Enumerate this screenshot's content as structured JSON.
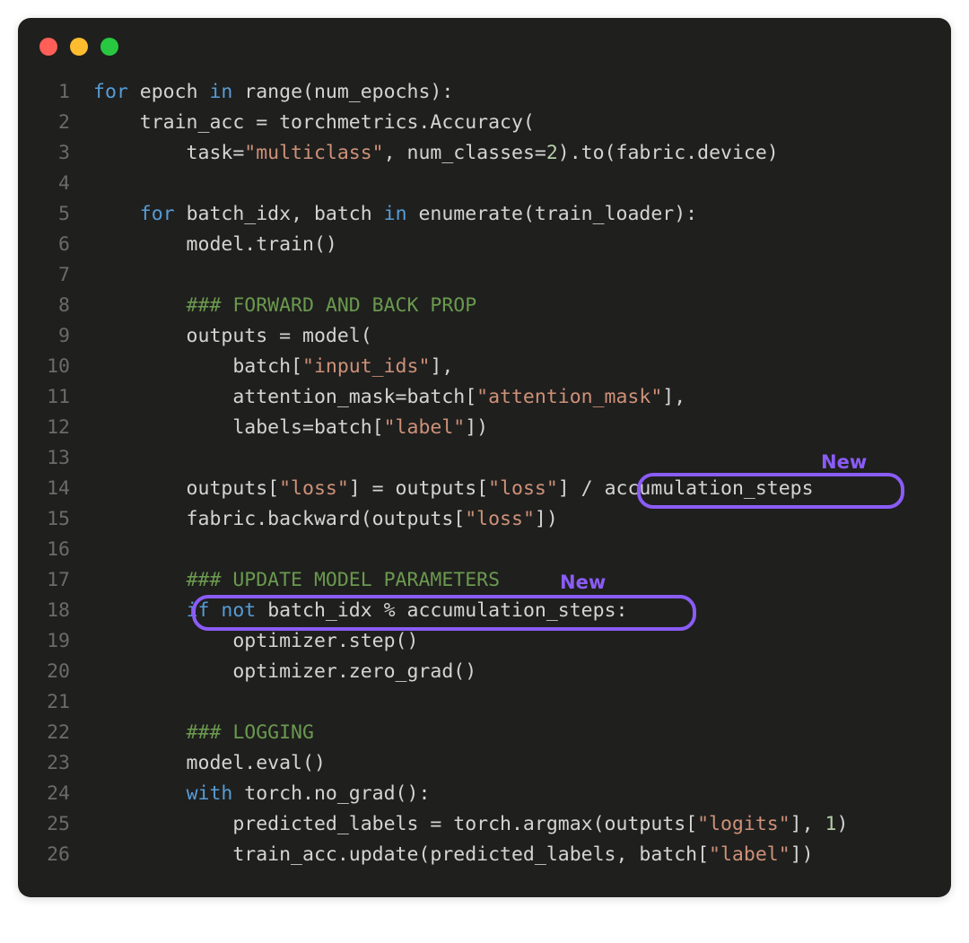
{
  "window": {
    "traffic_lights": [
      "close",
      "minimize",
      "zoom"
    ]
  },
  "annotations": {
    "new_label_1": "New",
    "new_label_2": "New"
  },
  "code": {
    "lines": [
      {
        "n": 1,
        "tokens": [
          [
            "kw",
            "for"
          ],
          [
            "id",
            " epoch "
          ],
          [
            "kw",
            "in"
          ],
          [
            "id",
            " range(num_epochs):"
          ]
        ]
      },
      {
        "n": 2,
        "tokens": [
          [
            "id",
            "    train_acc = torchmetrics.Accuracy("
          ]
        ]
      },
      {
        "n": 3,
        "tokens": [
          [
            "id",
            "        task="
          ],
          [
            "str",
            "\"multiclass\""
          ],
          [
            "id",
            ", num_classes="
          ],
          [
            "num",
            "2"
          ],
          [
            "id",
            ").to(fabric.device)"
          ]
        ]
      },
      {
        "n": 4,
        "tokens": [
          [
            "id",
            ""
          ]
        ]
      },
      {
        "n": 5,
        "tokens": [
          [
            "id",
            "    "
          ],
          [
            "kw",
            "for"
          ],
          [
            "id",
            " batch_idx, batch "
          ],
          [
            "kw",
            "in"
          ],
          [
            "id",
            " enumerate(train_loader):"
          ]
        ]
      },
      {
        "n": 6,
        "tokens": [
          [
            "id",
            "        model.train()"
          ]
        ]
      },
      {
        "n": 7,
        "tokens": [
          [
            "id",
            ""
          ]
        ]
      },
      {
        "n": 8,
        "tokens": [
          [
            "id",
            "        "
          ],
          [
            "cmt",
            "### FORWARD AND BACK PROP"
          ]
        ]
      },
      {
        "n": 9,
        "tokens": [
          [
            "id",
            "        outputs = model("
          ]
        ]
      },
      {
        "n": 10,
        "tokens": [
          [
            "id",
            "            batch["
          ],
          [
            "str",
            "\"input_ids\""
          ],
          [
            "id",
            "],"
          ]
        ]
      },
      {
        "n": 11,
        "tokens": [
          [
            "id",
            "            attention_mask=batch["
          ],
          [
            "str",
            "\"attention_mask\""
          ],
          [
            "id",
            "],"
          ]
        ]
      },
      {
        "n": 12,
        "tokens": [
          [
            "id",
            "            labels=batch["
          ],
          [
            "str",
            "\"label\""
          ],
          [
            "id",
            "])"
          ]
        ]
      },
      {
        "n": 13,
        "tokens": [
          [
            "id",
            ""
          ]
        ]
      },
      {
        "n": 14,
        "tokens": [
          [
            "id",
            "        outputs["
          ],
          [
            "str",
            "\"loss\""
          ],
          [
            "id",
            "] = outputs["
          ],
          [
            "str",
            "\"loss\""
          ],
          [
            "id",
            "] / accumulation_steps"
          ]
        ]
      },
      {
        "n": 15,
        "tokens": [
          [
            "id",
            "        fabric.backward(outputs["
          ],
          [
            "str",
            "\"loss\""
          ],
          [
            "id",
            "])"
          ]
        ]
      },
      {
        "n": 16,
        "tokens": [
          [
            "id",
            ""
          ]
        ]
      },
      {
        "n": 17,
        "tokens": [
          [
            "id",
            "        "
          ],
          [
            "cmt",
            "### UPDATE MODEL PARAMETERS"
          ]
        ]
      },
      {
        "n": 18,
        "tokens": [
          [
            "id",
            "        "
          ],
          [
            "kw",
            "if"
          ],
          [
            "id",
            " "
          ],
          [
            "kw",
            "not"
          ],
          [
            "id",
            " batch_idx % accumulation_steps:"
          ]
        ]
      },
      {
        "n": 19,
        "tokens": [
          [
            "id",
            "            optimizer.step()"
          ]
        ]
      },
      {
        "n": 20,
        "tokens": [
          [
            "id",
            "            optimizer.zero_grad()"
          ]
        ]
      },
      {
        "n": 21,
        "tokens": [
          [
            "id",
            ""
          ]
        ]
      },
      {
        "n": 22,
        "tokens": [
          [
            "id",
            "        "
          ],
          [
            "cmt",
            "### LOGGING"
          ]
        ]
      },
      {
        "n": 23,
        "tokens": [
          [
            "id",
            "        model.eval()"
          ]
        ]
      },
      {
        "n": 24,
        "tokens": [
          [
            "id",
            "        "
          ],
          [
            "kw",
            "with"
          ],
          [
            "id",
            " torch.no_grad():"
          ]
        ]
      },
      {
        "n": 25,
        "tokens": [
          [
            "id",
            "            predicted_labels = torch.argmax(outputs["
          ],
          [
            "str",
            "\"logits\""
          ],
          [
            "id",
            "], "
          ],
          [
            "num",
            "1"
          ],
          [
            "id",
            ")"
          ]
        ]
      },
      {
        "n": 26,
        "tokens": [
          [
            "id",
            "            train_acc.update(predicted_labels, batch["
          ],
          [
            "str",
            "\"label\""
          ],
          [
            "id",
            "])"
          ]
        ]
      }
    ]
  }
}
